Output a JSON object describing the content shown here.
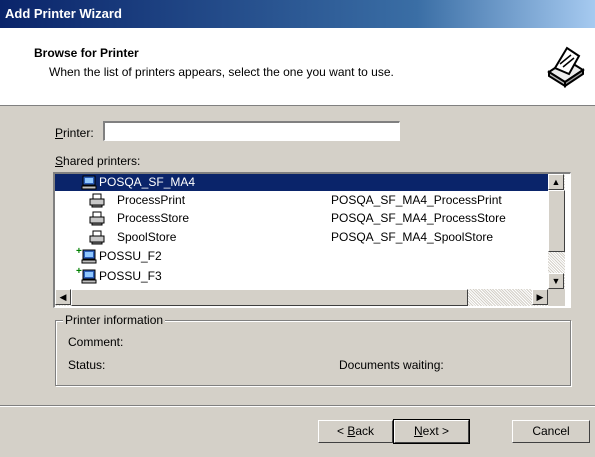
{
  "window": {
    "title": "Add Printer Wizard"
  },
  "header": {
    "title": "Browse for Printer",
    "subtitle": "When the list of printers appears, select the one you want to use."
  },
  "printer_field": {
    "label_prefix": "",
    "label_accel": "P",
    "label_rest": "rinter:",
    "value": ""
  },
  "shared": {
    "label_accel": "S",
    "label_rest": "hared printers:"
  },
  "tree": {
    "rows": [
      {
        "name": "POSQA_SF_MA4",
        "share": "",
        "icon": "computer-icon",
        "selected": true
      },
      {
        "name": "ProcessPrint",
        "share": "POSQA_SF_MA4_ProcessPrint",
        "icon": "printer-icon"
      },
      {
        "name": "ProcessStore",
        "share": "POSQA_SF_MA4_ProcessStore",
        "icon": "printer-icon"
      },
      {
        "name": "SpoolStore",
        "share": "POSQA_SF_MA4_SpoolStore",
        "icon": "printer-icon"
      },
      {
        "name": "POSSU_F2",
        "share": "",
        "icon": "computer-icon",
        "expand": "+"
      },
      {
        "name": "POSSU_F3",
        "share": "",
        "icon": "computer-icon",
        "expand": "+"
      }
    ]
  },
  "info": {
    "legend": "Printer information",
    "comment_label": "Comment:",
    "status_label": "Status:",
    "docs_label": "Documents waiting:"
  },
  "buttons": {
    "back_pre": "< ",
    "back_accel": "B",
    "back_rest": "ack",
    "next_accel": "N",
    "next_rest": "ext >",
    "cancel": "Cancel"
  }
}
